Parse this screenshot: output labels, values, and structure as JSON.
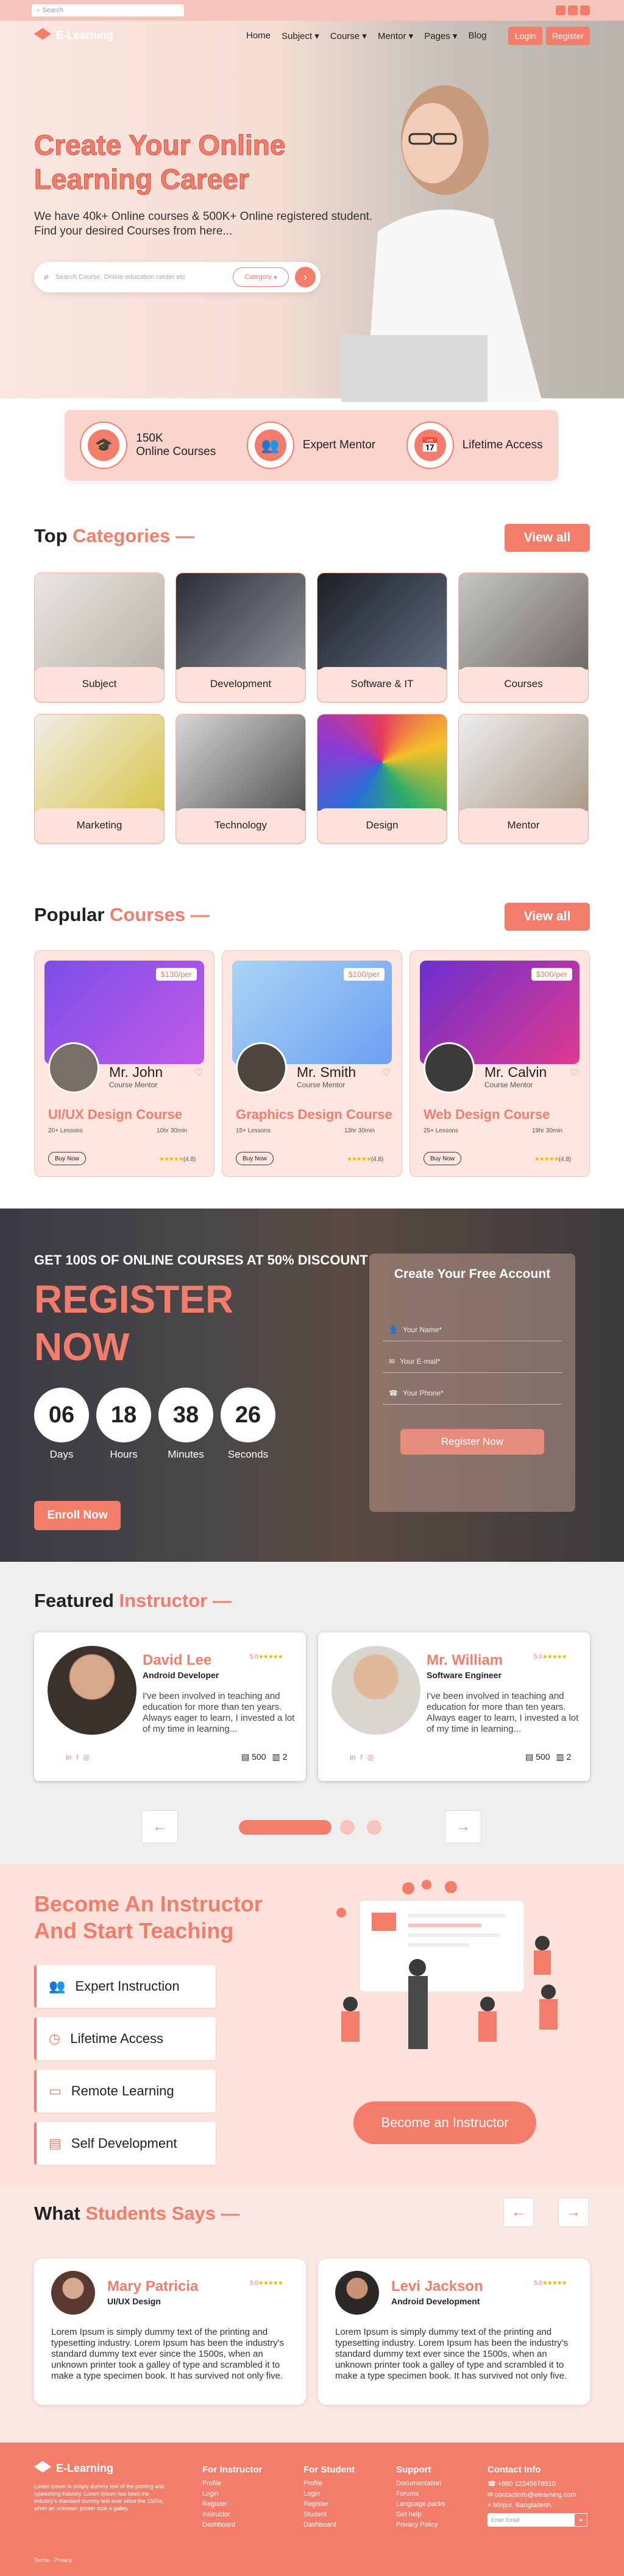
{
  "topbar": {
    "search_placeholder": "Search"
  },
  "brand": {
    "name": "E-Learning"
  },
  "nav": {
    "items": [
      "Home",
      "Subject",
      "Course",
      "Mentor",
      "Pages",
      "Blog"
    ],
    "login": "Login",
    "register": "Register"
  },
  "hero": {
    "title_line1": "Create Your Online",
    "title_line2": "Learning Career",
    "subtitle": "We have 40k+ Online courses & 500K+ Online registered student. Find your desired Courses from here...",
    "search_placeholder": "Search Course, Online education center etc",
    "category_label": "Category"
  },
  "stats": [
    {
      "line1": "150K",
      "line2": "Online Courses",
      "icon": "mortarboard-icon"
    },
    {
      "line1": "Expert Mentor",
      "line2": "",
      "icon": "people-icon"
    },
    {
      "line1": "Lifetime Access",
      "line2": "",
      "icon": "calendar-icon"
    }
  ],
  "categories": {
    "title_a": "Top",
    "title_b": "Categories —",
    "view_all": "View all",
    "items": [
      "Subject",
      "Development",
      "Software & IT",
      "Courses",
      "Marketing",
      "Technology",
      "Design",
      "Mentor"
    ]
  },
  "courses": {
    "title_a": "Popular",
    "title_b": "Courses —",
    "view_all": "View all",
    "items": [
      {
        "price": "$130",
        "per": "/per",
        "mentor": "Mr. John",
        "role": "Course Mentor",
        "title": "UI/UX Design Course",
        "lessons": "20+ Lessons",
        "hours": "10hr 30min",
        "buy": "Buy Now",
        "rating": "(4.8)"
      },
      {
        "price": "$100",
        "per": "/per",
        "mentor": "Mr. Smith",
        "role": "Course Mentor",
        "title": "Graphics Design Course",
        "lessons": "15+ Lessons",
        "hours": "13hr 30min",
        "buy": "Buy Now",
        "rating": "(4.8)"
      },
      {
        "price": "$300",
        "per": "/per",
        "mentor": "Mr. Calvin",
        "role": "Course Mentor",
        "title": "Web Design Course",
        "lessons": "25+ Lessons",
        "hours": "19hr 30min",
        "buy": "Buy Now",
        "rating": "(4.8)"
      }
    ]
  },
  "register": {
    "top": "GET 100S OF ONLINE COURSES AT 50% DISCOUNT",
    "big1": "REGISTER",
    "big2": "NOW",
    "countdown": [
      {
        "v": "06",
        "l": "Days"
      },
      {
        "v": "18",
        "l": "Hours"
      },
      {
        "v": "38",
        "l": "Minutes"
      },
      {
        "v": "26",
        "l": "Seconds"
      }
    ],
    "enroll": "Enroll Now",
    "form_title": "Create Your Free Account",
    "fields": [
      "Your Name*",
      "Your E-mail*",
      "Your Phone*"
    ],
    "submit": "Register Now"
  },
  "instructors": {
    "title_a": "Featured",
    "title_b": "Instructor —",
    "items": [
      {
        "name": "David Lee",
        "role": "Android Developer",
        "rating": "5.0",
        "bio": "I've been involved in teaching and education for more than ten years. Always eager to learn, I invested a lot of my time in learning...",
        "courses": "500",
        "count2": "2"
      },
      {
        "name": "Mr. William",
        "role": "Software Engineer",
        "rating": "5.0",
        "bio": "I've been involved in teaching and education for more than ten years. Always eager to learn, I invested a lot of my time in learning...",
        "courses": "500",
        "count2": "2"
      }
    ]
  },
  "become": {
    "title1": "Become An Instructor",
    "title2": "And Start Teaching",
    "features": [
      {
        "label": "Expert Instruction",
        "icon": "people-icon"
      },
      {
        "label": "Lifetime Access",
        "icon": "clock-icon"
      },
      {
        "label": "Remote Learning",
        "icon": "monitor-icon"
      },
      {
        "label": "Self Development",
        "icon": "book-icon"
      }
    ],
    "cta": "Become an Instructor"
  },
  "testimonials": {
    "title_a": "What",
    "title_b": "Students Says —",
    "items": [
      {
        "name": "Mary Patricia",
        "role": "UI/UX Design",
        "rating": "5.0",
        "text": "Lorem Ipsum is simply dummy text of the printing and typesetting industry. Lorem Ipsum has been the industry's standard dummy text ever since the 1500s, when an unknown printer took a galley of type and scrambled it to make a type specimen book. It has survived not only five."
      },
      {
        "name": "Levi Jackson",
        "role": "Android Development",
        "rating": "5.0",
        "text": "Lorem Ipsum is simply dummy text of the printing and typesetting industry. Lorem Ipsum has been the industry's standard dummy text ever since the 1500s, when an unknown printer took a galley of type and scrambled it to make a type specimen book. It has survived not only five."
      }
    ]
  },
  "footer": {
    "about": "Lorem Ipsum is simply dummy text of the printing and typesetting industry. Lorem Ipsum has been the industry's standard dummy text ever since the 1500s, when an unknown printer took a galley.",
    "cols": [
      {
        "h": "For Instructor",
        "links": [
          "Profile",
          "Login",
          "Register",
          "Instructor",
          "Dashboard"
        ]
      },
      {
        "h": "For Student",
        "links": [
          "Profile",
          "Login",
          "Register",
          "Student",
          "Dashboard"
        ]
      },
      {
        "h": "Support",
        "links": [
          "Documentation",
          "Forums",
          "Language packs",
          "Get help",
          "Privacy Policy"
        ]
      }
    ],
    "contact_h": "Contact Info",
    "contact": [
      "+880 12345678910",
      "contactinfo@elearning.com",
      "Mirpur, Bangladesh"
    ],
    "subscribe_placeholder": "Enter Email",
    "bottom": "Terms · Privacy"
  }
}
